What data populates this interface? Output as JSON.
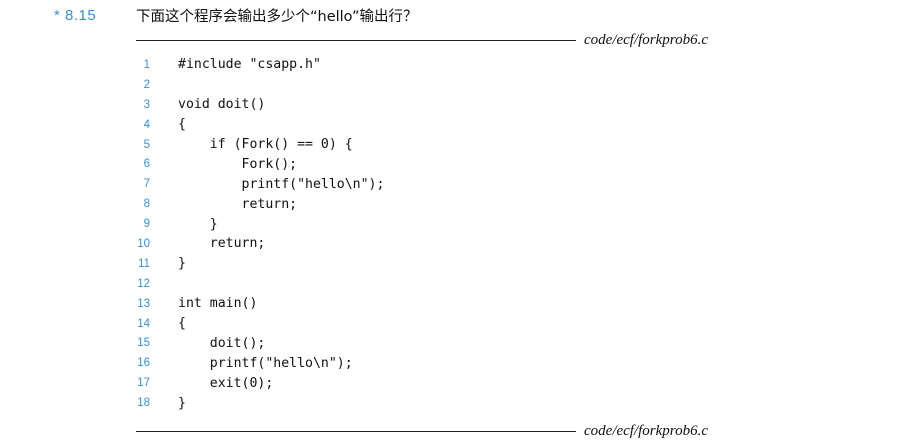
{
  "problem": {
    "number": "* 8.15",
    "text": "下面这个程序会输出多少个“hello”输出行？"
  },
  "listing": {
    "file_top": "code/ecf/forkprob6.c",
    "file_bottom": "code/ecf/forkprob6.c",
    "lines": [
      {
        "no": "1",
        "text": "#include \"csapp.h\""
      },
      {
        "no": "2",
        "text": ""
      },
      {
        "no": "3",
        "text": "void doit()"
      },
      {
        "no": "4",
        "text": "{"
      },
      {
        "no": "5",
        "text": "    if (Fork() == 0) {"
      },
      {
        "no": "6",
        "text": "        Fork();"
      },
      {
        "no": "7",
        "text": "        printf(\"hello\\n\");"
      },
      {
        "no": "8",
        "text": "        return;"
      },
      {
        "no": "9",
        "text": "    }"
      },
      {
        "no": "10",
        "text": "    return;"
      },
      {
        "no": "11",
        "text": "}"
      },
      {
        "no": "12",
        "text": ""
      },
      {
        "no": "13",
        "text": "int main()"
      },
      {
        "no": "14",
        "text": "{"
      },
      {
        "no": "15",
        "text": "    doit();"
      },
      {
        "no": "16",
        "text": "    printf(\"hello\\n\");"
      },
      {
        "no": "17",
        "text": "    exit(0);"
      },
      {
        "no": "18",
        "text": "}"
      }
    ]
  }
}
